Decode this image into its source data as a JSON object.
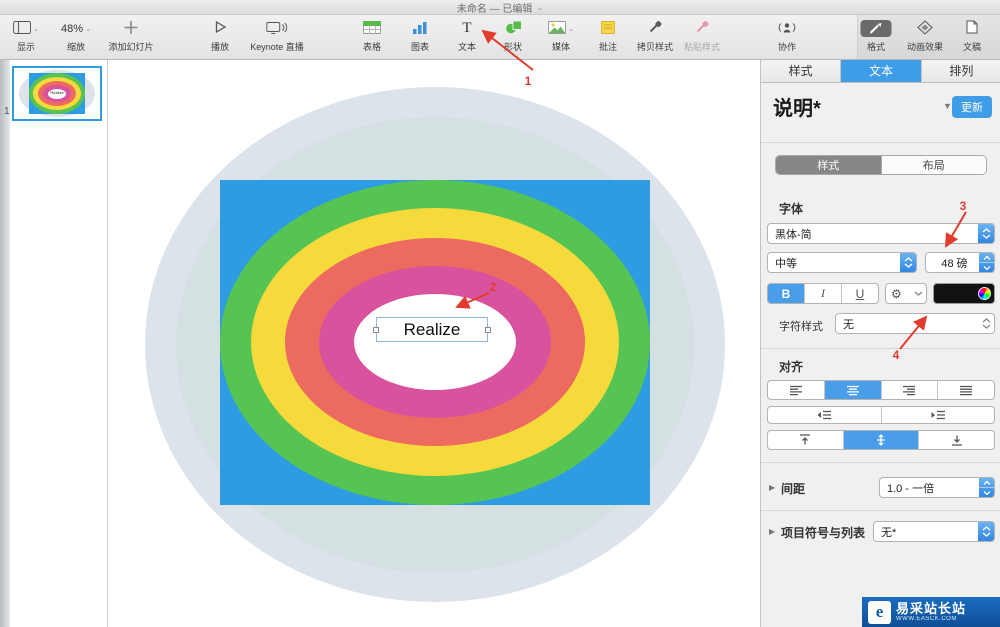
{
  "window": {
    "title": "未命名 — 已编辑"
  },
  "toolbar": {
    "view_label": "显示",
    "zoom_value": "48%",
    "zoom_label": "缩放",
    "add_slide_label": "添加幻灯片",
    "play_label": "播放",
    "live_label": "Keynote 直播",
    "table_label": "表格",
    "chart_label": "图表",
    "text_label": "文本",
    "shape_label": "形状",
    "media_label": "媒体",
    "comment_label": "批注",
    "copy_style_label": "拷贝样式",
    "paste_style_label": "粘贴样式",
    "collab_label": "协作",
    "format_label": "格式",
    "animate_label": "动画效果",
    "document_label": "文稿"
  },
  "sidebar": {
    "slide_number": "1"
  },
  "canvas": {
    "text_box_value": "Realize"
  },
  "inspector": {
    "tabs": [
      {
        "label": "样式"
      },
      {
        "label": "文本"
      },
      {
        "label": "排列"
      }
    ],
    "title": "说明*",
    "update_label": "更新",
    "segments": [
      {
        "label": "样式"
      },
      {
        "label": "布局"
      }
    ],
    "font_section": "字体",
    "font_family": "黑体-简",
    "font_weight": "中等",
    "font_size": "48 磅",
    "bold": "B",
    "italic": "I",
    "underline": "U",
    "char_style_label": "字符样式",
    "char_style_value": "无",
    "align_section": "对齐",
    "spacing_label": "间距",
    "spacing_value": "1.0 - 一倍",
    "bullets_label": "项目符号与列表",
    "bullets_value": "无*"
  },
  "annotations": {
    "n1": "1",
    "n2": "2",
    "n3": "3",
    "n4": "4"
  },
  "colors": {
    "accent_blue": "#3f9de8",
    "shape_blue": "#2d9ce3",
    "shape_green": "#55c453",
    "shape_yellow": "#f6d93b",
    "shape_salmon": "#ec6a5f",
    "shape_pink": "#d9529e",
    "arrow_red": "#e23b2e"
  },
  "watermark": {
    "title": "易采站长站",
    "subtitle": "WWW.EASCK.COM"
  }
}
